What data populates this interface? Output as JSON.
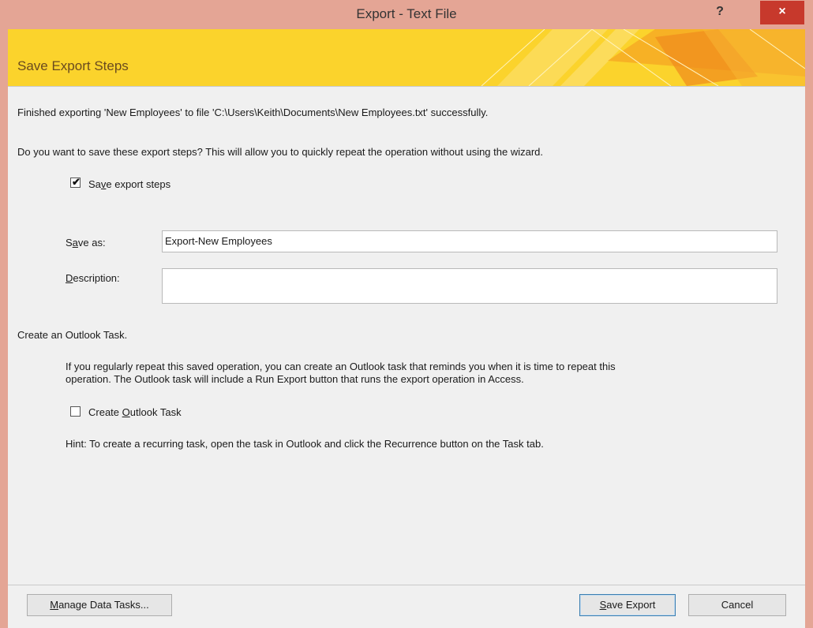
{
  "window": {
    "title": "Export - Text File",
    "help_label": "?",
    "close_label": "×"
  },
  "banner": {
    "title": "Save Export Steps"
  },
  "content": {
    "finished_message": "Finished exporting 'New Employees' to file 'C:\\Users\\Keith\\Documents\\New Employees.txt' successfully.",
    "question": "Do you want to save these export steps? This will allow you to quickly repeat the operation without using the wizard.",
    "save_steps": {
      "label_pre": "Sa",
      "label_accel": "v",
      "label_post": "e export steps",
      "checked": true
    },
    "save_as": {
      "label_pre": "S",
      "label_accel": "a",
      "label_post": "ve as:",
      "value": "Export-New Employees"
    },
    "description": {
      "label_pre": "",
      "label_accel": "D",
      "label_post": "escription:",
      "value": ""
    },
    "outlook_heading": "Create an Outlook Task.",
    "outlook_info_line1": "If you regularly repeat this saved operation, you can create an Outlook task that reminds you when it is time to repeat this",
    "outlook_info_line2": "operation. The Outlook task will include a Run Export button that runs the export operation in Access.",
    "create_task": {
      "label_pre": "Create ",
      "label_accel": "O",
      "label_post": "utlook Task",
      "checked": false
    },
    "hint": "Hint: To create a recurring task, open the task in Outlook and click the Recurrence button on the Task tab."
  },
  "footer": {
    "manage_pre": "",
    "manage_accel": "M",
    "manage_post": "anage Data Tasks...",
    "save_pre": "",
    "save_accel": "S",
    "save_post": "ave Export",
    "cancel_label": "Cancel"
  },
  "colors": {
    "titlebar": "#e4a595",
    "close": "#c7392c",
    "banner": "#fbd32c",
    "banner_text": "#6a4b1f"
  }
}
